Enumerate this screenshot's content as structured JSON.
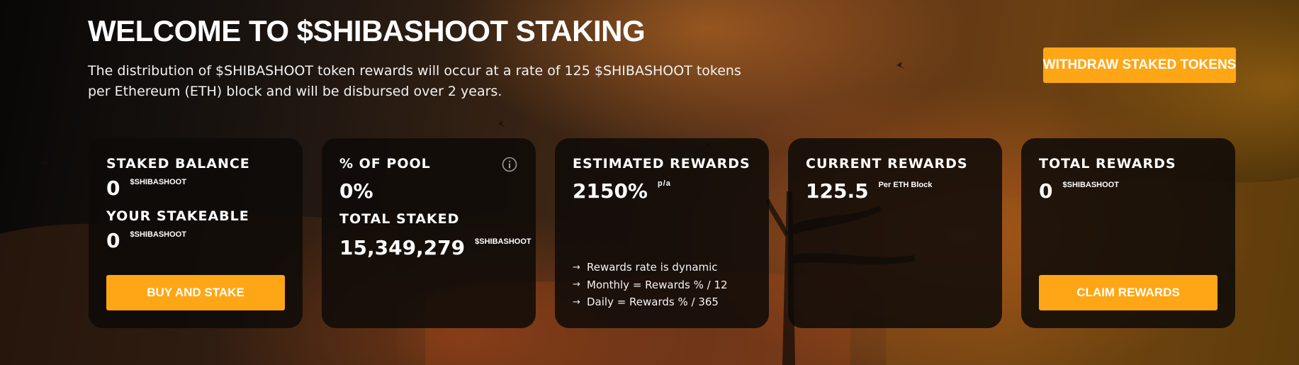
{
  "hero": {
    "title": "WELCOME TO $SHIBASHOOT STAKING",
    "description": "The distribution of $SHIBASHOOT token rewards will occur at a rate of 125 $SHIBASHOOT tokens per Ethereum (ETH) block and will be disbursed over 2 years."
  },
  "actions": {
    "withdraw_label": "WITHDRAW STAKED TOKENS"
  },
  "cards": {
    "staked": {
      "label": "STAKED BALANCE",
      "value": "0",
      "unit": "$SHIBASHOOT",
      "stakeable_label": "YOUR STAKEABLE",
      "stakeable_value": "0",
      "stakeable_unit": "$SHIBASHOOT",
      "button": "BUY AND STAKE"
    },
    "pool": {
      "label": "% OF POOL",
      "value": "0%",
      "total_label": "TOTAL STAKED",
      "total_value": "15,349,279",
      "total_unit": "$SHIBASHOOT",
      "info_icon": "info-icon"
    },
    "estimated": {
      "label": "ESTIMATED REWARDS",
      "value": "2150%",
      "unit": "p/a",
      "notes": [
        "Rewards rate is dynamic",
        "Monthly = Rewards % / 12",
        "Daily = Rewards % / 365"
      ],
      "note_icon": "arrow-right-icon"
    },
    "current": {
      "label": "CURRENT REWARDS",
      "value": "125.5",
      "unit": "Per ETH Block"
    },
    "total": {
      "label": "TOTAL REWARDS",
      "value": "0",
      "unit": "$SHIBASHOOT",
      "button": "CLAIM REWARDS"
    }
  },
  "colors": {
    "accent": "#ffa616",
    "card_bg": "#0e0a08",
    "text": "#ffffff"
  }
}
